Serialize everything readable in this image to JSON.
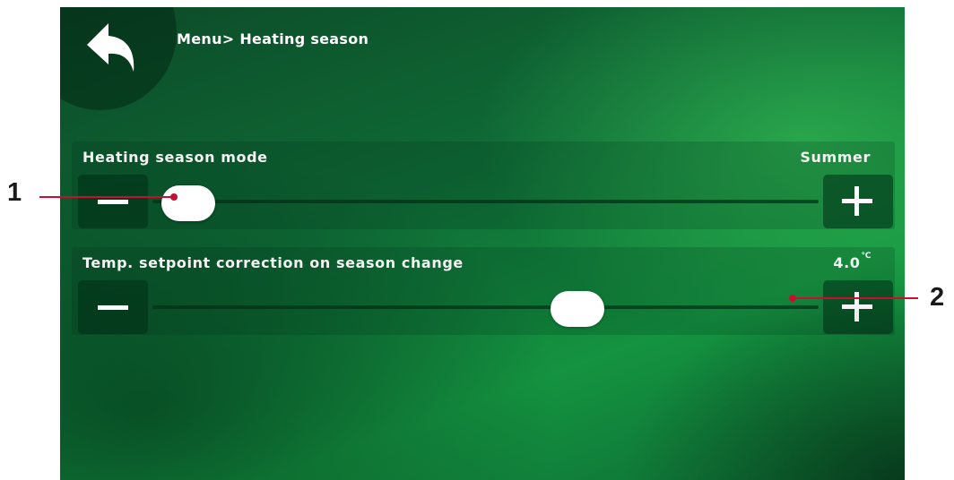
{
  "breadcrumb": "Menu> Heating season",
  "icons": {
    "back": "back-arrow-icon",
    "minus": "minus-icon",
    "plus": "plus-icon"
  },
  "settings": [
    {
      "label": "Heating season mode",
      "value": "Summer",
      "unit": "",
      "slider_level": 0.0
    },
    {
      "label": "Temp. setpoint correction on season change",
      "value": "4.0",
      "unit": "℃",
      "slider_level": 0.62
    }
  ],
  "callouts": [
    "1",
    "2"
  ],
  "colors": {
    "accent_callout": "#c8102e",
    "screen_green": "#149340"
  }
}
